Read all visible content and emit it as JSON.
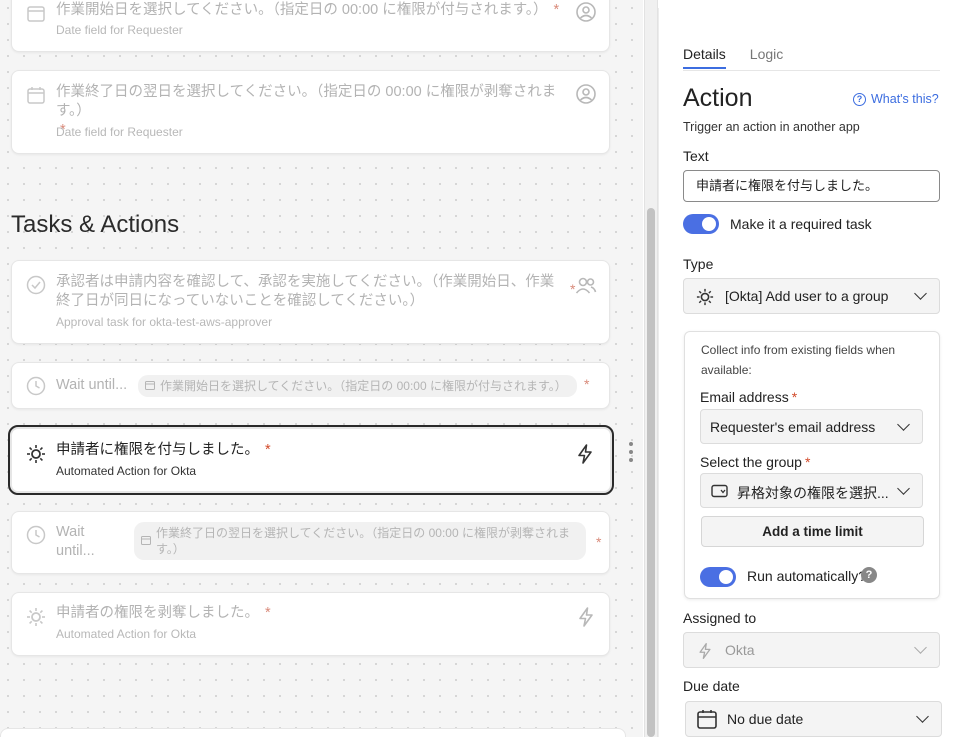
{
  "canvas": {
    "date_field_1": {
      "title": "作業開始日を選択してください。（指定日の 00:00 に権限が付与されます。）",
      "required": "*",
      "subtitle": "Date field for Requester"
    },
    "date_field_2": {
      "title": "作業終了日の翌日を選択してください。（指定日の 00:00 に権限が剥奪されます。）",
      "required": "*",
      "subtitle": "Date field for Requester"
    },
    "section_title": "Tasks & Actions",
    "approval_task": {
      "title": "承認者は申請内容を確認して、承認を実施してください。（作業開始日、作業終了日が同日になっていないことを確認してください。）",
      "required": "*",
      "subtitle": "Approval task for okta-test-aws-approver"
    },
    "wait_1": {
      "label": "Wait until...",
      "chip": "作業開始日を選択してください。（指定日の 00:00 に権限が付与されます。）",
      "required": "*"
    },
    "action_selected": {
      "title": "申請者に権限を付与しました。",
      "required": "*",
      "subtitle": "Automated Action for Okta"
    },
    "wait_2": {
      "label_line1": "Wait",
      "label_line2": "until...",
      "chip": "作業終了日の翌日を選択してください。（指定日の 00:00 に権限が剥奪されます。）",
      "required": "*"
    },
    "action_2": {
      "title": "申請者の権限を剥奪しました。",
      "required": "*",
      "subtitle": "Automated Action for Okta"
    }
  },
  "panel": {
    "tabs": [
      {
        "label": "Details",
        "active": true
      },
      {
        "label": "Logic",
        "active": false
      }
    ],
    "title": "Action",
    "whats_this": "What's this?",
    "description": "Trigger an action in another app",
    "text_label": "Text",
    "text_value": "申請者に権限を付与しました。",
    "required_task_label": "Make it a required task",
    "type_label": "Type",
    "type_value": "[Okta] Add user to a group",
    "collect_desc": "Collect info from existing fields when available:",
    "email_label": "Email address",
    "email_value": "Requester's email address",
    "group_label": "Select the group",
    "group_value": "昇格対象の権限を選択...",
    "required_mark": "*",
    "time_limit_button": "Add a time limit",
    "run_auto_label": "Run automatically?",
    "help_glyph": "?",
    "assigned_label": "Assigned to",
    "assigned_value": "Okta",
    "due_label": "Due date",
    "due_value": "No due date"
  },
  "colors": {
    "accent": "#3c6de0",
    "toggle": "#4a6fe3",
    "required": "#d24a2a"
  }
}
